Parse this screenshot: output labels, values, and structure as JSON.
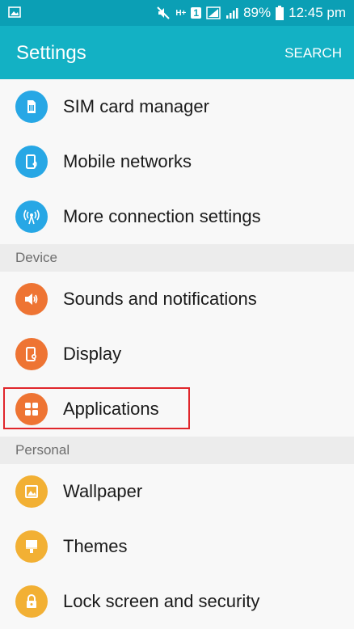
{
  "status_bar": {
    "network_type": "H+",
    "sim_slot": "1",
    "battery": "89%",
    "time": "12:45 pm"
  },
  "app_bar": {
    "title": "Settings",
    "search_label": "SEARCH"
  },
  "connections": {
    "items": [
      {
        "label": "SIM card manager",
        "icon": "sim-card-icon"
      },
      {
        "label": "Mobile networks",
        "icon": "mobile-networks-icon"
      },
      {
        "label": "More connection settings",
        "icon": "wifi-tower-icon"
      }
    ]
  },
  "device": {
    "title": "Device",
    "items": [
      {
        "label": "Sounds and notifications",
        "icon": "speaker-icon"
      },
      {
        "label": "Display",
        "icon": "display-icon"
      },
      {
        "label": "Applications",
        "icon": "applications-icon"
      }
    ]
  },
  "personal": {
    "title": "Personal",
    "items": [
      {
        "label": "Wallpaper",
        "icon": "wallpaper-icon"
      },
      {
        "label": "Themes",
        "icon": "themes-icon"
      },
      {
        "label": "Lock screen and security",
        "icon": "lock-icon"
      }
    ]
  },
  "colors": {
    "status_bar": "#0b9fb5",
    "app_bar": "#13b1c4",
    "connections_icon": "#27a7e5",
    "device_icon": "#ee7433",
    "personal_icon": "#f2b034",
    "highlight_box": "#e0262b"
  }
}
